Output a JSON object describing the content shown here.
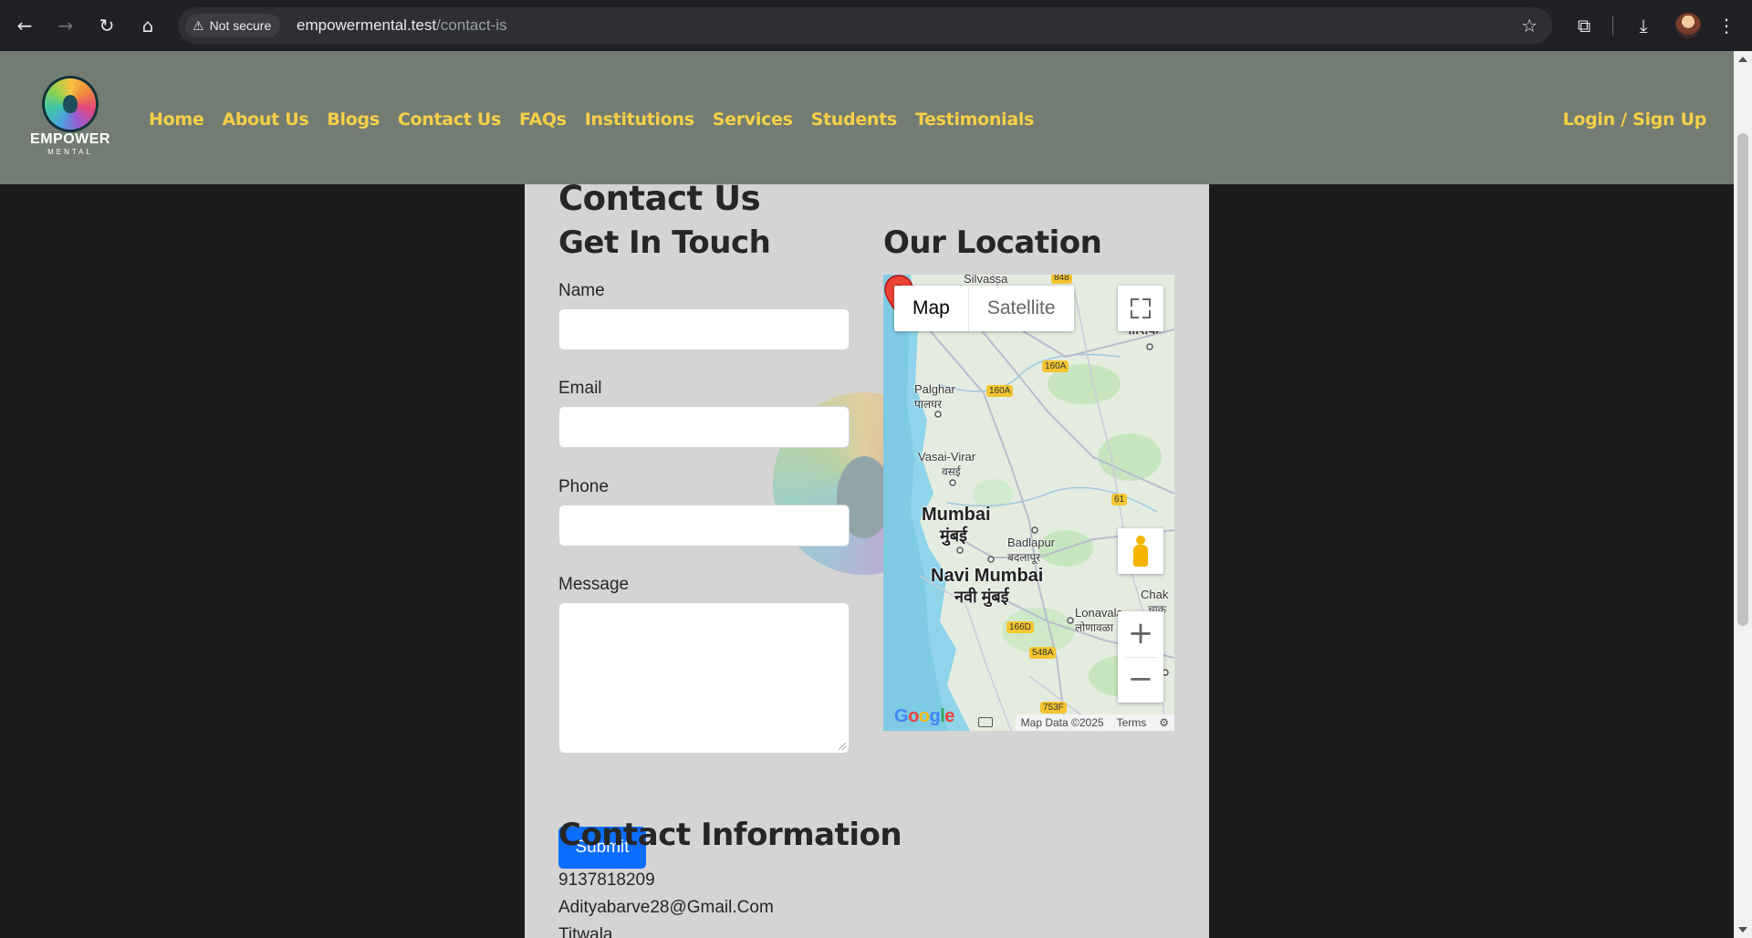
{
  "browser": {
    "security_label": "Not secure",
    "url_host": "empowermental.test",
    "url_path": "/contact-is"
  },
  "logo": {
    "line1": "EMPOWER",
    "line2": "MENTAL"
  },
  "nav": {
    "items": [
      {
        "label": "Home"
      },
      {
        "label": "About Us"
      },
      {
        "label": "Blogs"
      },
      {
        "label": "Contact Us"
      },
      {
        "label": "FAQs"
      },
      {
        "label": "Institutions"
      },
      {
        "label": "Services"
      },
      {
        "label": "Students"
      },
      {
        "label": "Testimonials"
      }
    ],
    "login_label": "Login / Sign Up"
  },
  "page": {
    "title": "Contact Us"
  },
  "form": {
    "heading": "Get In Touch",
    "name_label": "Name",
    "name_value": "",
    "email_label": "Email",
    "email_value": "",
    "phone_label": "Phone",
    "phone_value": "",
    "message_label": "Message",
    "message_value": "",
    "submit_label": "Submit"
  },
  "location": {
    "heading": "Our Location",
    "map_tab_map": "Map",
    "map_tab_satellite": "Satellite",
    "attribution_data": "Map Data ©2025",
    "attribution_terms": "Terms",
    "google_logo": "Google",
    "labels": {
      "silvassa": "Silvassa",
      "palghar": "Palghar",
      "palghar_local": "पालघर",
      "vasai": "Vasai-Virar",
      "vasai_local": "वसई",
      "mumbai": "Mumbai",
      "mumbai_local": "मुंबई",
      "badlapur": "Badlapur",
      "badlapur_local": "बदलापूर",
      "navi_mumbai": "Navi Mumbai",
      "navi_mumbai_local": "नवी मुंबई",
      "lonavala": "Lonavala",
      "lonavala_local": "लोणावळा",
      "nashik_partial": "नाशिक",
      "nashik_partial_top": "il",
      "chakan_partial": "Chak",
      "chakan_partial_local": "चाक"
    },
    "shields": {
      "s848": "848",
      "s160a_1": "160A",
      "s160a_2": "160A",
      "s61": "61",
      "s166d": "166D",
      "s548a": "548A",
      "s753f": "753F"
    }
  },
  "contact_info": {
    "heading": "Contact Information",
    "phone": "9137818209",
    "email": "Adityabarve28@Gmail.Com",
    "city": "Titwala"
  },
  "colors": {
    "header_bg": "#727c72",
    "nav_text": "#f7d048",
    "card_bg": "#d4d4d4",
    "page_bg": "#1b1b1b",
    "submit_bg": "#0d6efd"
  }
}
